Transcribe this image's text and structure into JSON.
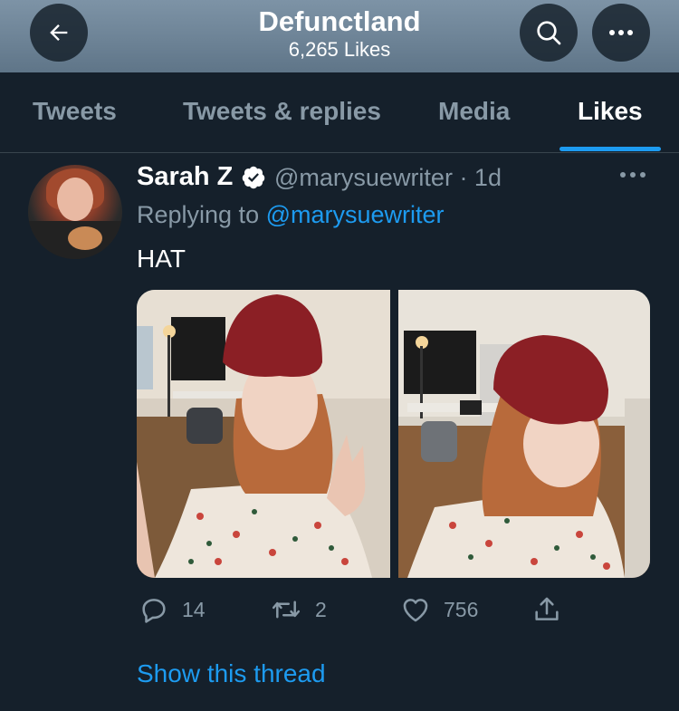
{
  "header": {
    "title": "Defunctland",
    "subtitle": "6,265 Likes"
  },
  "tabs": [
    {
      "label": "Tweets",
      "active": false
    },
    {
      "label": "Tweets & replies",
      "active": false
    },
    {
      "label": "Media",
      "active": false
    },
    {
      "label": "Likes",
      "active": true
    }
  ],
  "tweet": {
    "author_name": "Sarah Z",
    "verified": true,
    "handle_time": "@marysuewriter · 1d",
    "replying_prefix": "Replying to",
    "replying_handle": "@marysuewriter",
    "text": "HAT",
    "media_count": 2,
    "actions": {
      "replies": "14",
      "retweets": "2",
      "likes": "756"
    },
    "show_thread": "Show this thread"
  },
  "icons": {
    "back": "arrow-left-icon",
    "search": "search-icon",
    "more": "more-horizontal-icon",
    "verified": "verified-badge-icon",
    "reply": "reply-bubble-icon",
    "retweet": "retweet-icon",
    "like": "heart-icon",
    "share": "share-icon"
  },
  "colors": {
    "background": "#15202b",
    "accent": "#1d9bf0",
    "muted_text": "#8899a6",
    "divider": "#38444d"
  }
}
